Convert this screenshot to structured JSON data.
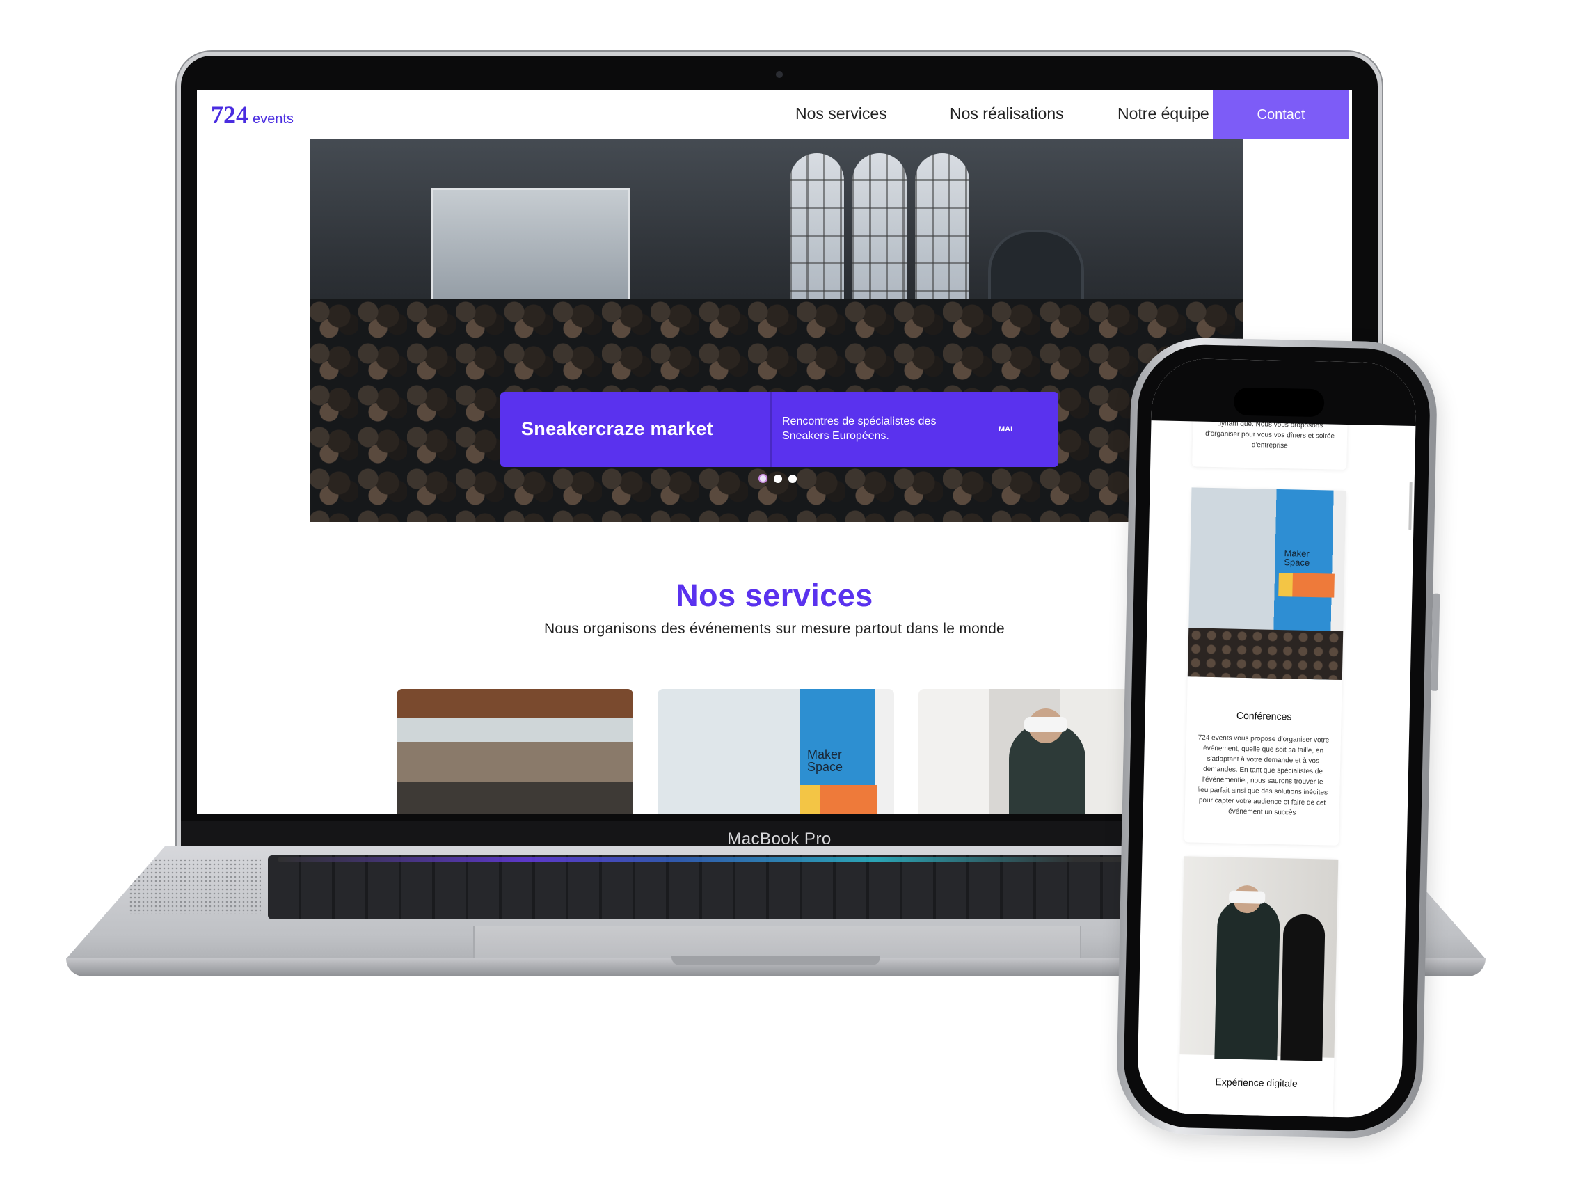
{
  "laptop": {
    "brand": "MacBook Pro"
  },
  "site": {
    "logo_number": "724",
    "logo_text": "events",
    "nav": [
      "Nos services",
      "Nos réalisations",
      "Notre équipe"
    ],
    "contact_label": "Contact",
    "slider": {
      "title": "Sneakercraze market",
      "description": "Rencontres de spécialistes des Sneakers Européens.",
      "month": "MAI",
      "dots": 3,
      "active_dot": 0
    },
    "services": {
      "title": "Nos services",
      "subtitle": "Nous organisons des événements sur mesure partout dans le monde"
    }
  },
  "phone": {
    "card0_text": "votre soirée d'entreprise, votre mariage dynam que. Nous vous proposons d'organiser pour vous vos dîners et soirée d'entreprise",
    "card1_title": "Conférences",
    "card1_text": "724 events vous propose d'organiser votre événement, quelle que soit sa taille, en s'adaptant à votre demande et à vos demandes. En tant que spécialistes de l'événementiel, nous saurons trouver le lieu parfait ainsi que des solutions inédites pour capter votre audience et faire de cet événement un succès",
    "card2_title": "Expérience digitale"
  },
  "colors": {
    "primary": "#5a32ee",
    "contact": "#7d5cf7",
    "accent_orange": "#ee7a3a"
  }
}
